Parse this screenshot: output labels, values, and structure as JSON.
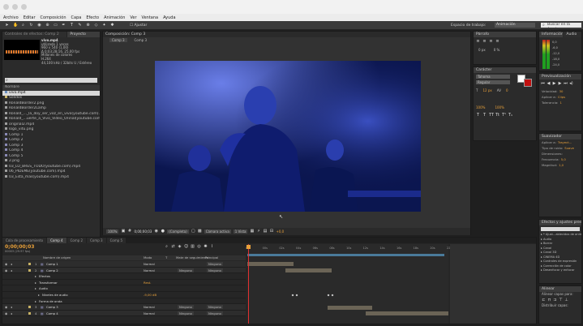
{
  "menu": {
    "items": [
      "Archivo",
      "Editar",
      "Composición",
      "Capa",
      "Efecto",
      "Animación",
      "Ver",
      "Ventana",
      "Ayuda"
    ]
  },
  "toolbar": {
    "snap_label": "Ajustar",
    "workspace_label": "Espacio de trabajo:",
    "workspace_value": "Animación",
    "help_placeholder": "Buscar en la Ayuda"
  },
  "project": {
    "tab_effects": "Controles de efectos: Comp 2",
    "tab_project": "Proyecto",
    "item_name": "vivo.mp4",
    "item_info": [
      "utilizado 1 veces",
      "960 x 540 (1,00)",
      "Δ 0;03;28;16, 25,00 fps",
      "Millones de colores",
      "H.264",
      "44,100 kHz / 32bits U / Estéreo"
    ],
    "search_placeholder": "",
    "col_name": "Nombre",
    "files": [
      {
        "name": "vivo.mp4",
        "color": "#6a8fbf",
        "selected": true
      },
      {
        "name": "Sólidos",
        "color": "#c8b264"
      },
      {
        "name": "RonaldBorder2.png",
        "color": "#9f9f9f"
      },
      {
        "name": "RonaldBorder2Lamp",
        "color": "#9f9f9f"
      },
      {
        "name": "Ronald_..._la_doy_ser_voz_en_vivo(youtube.com).mp4",
        "color": "#9f9f9f"
      },
      {
        "name": "Ronald_...uerte_a_Vivo_Video_OFinal(youtube.com).mp4",
        "color": "#9f9f9f"
      },
      {
        "name": "original2.mp4",
        "color": "#9f9f9f"
      },
      {
        "name": "logo_vitu.png",
        "color": "#9f9f9f"
      },
      {
        "name": "Comp 1",
        "color": "#8a8ab5"
      },
      {
        "name": "Comp 2",
        "color": "#8a8ab5"
      },
      {
        "name": "Comp 3",
        "color": "#8a8ab5"
      },
      {
        "name": "Comp 4",
        "color": "#8a8ab5"
      },
      {
        "name": "Comp 5",
        "color": "#8a8ab5"
      },
      {
        "name": "2.png",
        "color": "#9f9f9f"
      },
      {
        "name": "03_LO_BRES_TODO(youtube.com).mp4",
        "color": "#9f9f9f"
      },
      {
        "name": "06_PIDEME(youtube.com).mp4",
        "color": "#9f9f9f"
      },
      {
        "name": "03_Esta_mas(youtube.com).mp4",
        "color": "#9f9f9f"
      }
    ]
  },
  "composition": {
    "tab": "Composición: Comp 3",
    "subtabs": [
      "Comp 3",
      "Comp 3"
    ],
    "zoom": "100%",
    "timecode": "0;00;00;03",
    "resolution": "(Completa)",
    "camera": "Cámara activa",
    "views": "1 Vista",
    "offset": "+0,0"
  },
  "right_panels": {
    "info_tab": "Información",
    "audio_tab": "Audio",
    "audio_levels": [
      "0,0",
      "-6,0",
      "-12,0",
      "-18,0",
      "-24,0"
    ],
    "preview_tab": "Previsualización",
    "preview_fields": [
      {
        "label": "Velocidad:",
        "value": "30"
      },
      {
        "label": "Aplicar a:",
        "value": "Clips"
      },
      {
        "label": "Tolerancia:",
        "value": "1"
      }
    ],
    "smoother_tab": "Suavizador",
    "smoother_fields": [
      {
        "label": "Aplicar a:",
        "value": "Trayect..."
      },
      {
        "label": "Tipo de ruido:",
        "value": "Suave"
      },
      {
        "label": "Dimensiones:",
        "value": ""
      },
      {
        "label": "Frecuencia:",
        "value": "5,0"
      },
      {
        "label": "Magnitud:",
        "value": "1,0"
      }
    ],
    "effects_tab": "Efectos y ajustes preestablecidos",
    "effects_list": [
      "* Ajust...ablecidos de animación",
      "Audio",
      "Borrar",
      "Canal",
      "Canal 3D",
      "CINEMA 4D",
      "Controles de expresión",
      "Corrección de color",
      "Desenfocar y enfocar"
    ],
    "align_tab": "Alinear",
    "align_label": "Alinear capas para:",
    "distribute_label": "Distribuir capas:"
  },
  "paragraph": {
    "tab": "Carácter",
    "tab2": "Párrafo",
    "font": "Tahoma",
    "style": "Regular",
    "size": "12 px",
    "tracking": "0",
    "percents": [
      "100%",
      "100%"
    ],
    "px_values": [
      "0 px",
      "0 %"
    ]
  },
  "timeline": {
    "tabs": [
      "Cola de procesamiento",
      "Comp 4",
      "Comp 2",
      "Comp 3",
      "Comp 5"
    ],
    "timecode": "0;00;00;03",
    "fps_note": "00003 (29.97 fps)",
    "cols": [
      "Nombre de origen",
      "Modo",
      "T",
      "Mate de seguimiento",
      "Principal"
    ],
    "ruler": [
      "0s",
      "00s",
      "02s",
      "04s",
      "06s",
      "08s",
      "10s",
      "12s",
      "14s",
      "16s",
      "18s",
      "20s",
      "22s"
    ],
    "layers": [
      {
        "num": "1",
        "name": "Comp 1",
        "mode": "Normal",
        "track": "",
        "parent": "Ninguno",
        "indent": 0,
        "bar_start": 0.0,
        "bar_end": 0.23,
        "bar_color": "#6b6456",
        "kind": "layer"
      },
      {
        "num": "2",
        "name": "Comp 2",
        "mode": "Normal",
        "track": "Ninguno",
        "parent": "Ninguno",
        "indent": 0,
        "bar_start": 0.19,
        "bar_end": 0.42,
        "bar_color": "#6b6456",
        "kind": "layer"
      },
      {
        "num": "",
        "name": "Efectos",
        "mode": "",
        "track": "",
        "parent": "",
        "indent": 1,
        "kind": "prop"
      },
      {
        "num": "",
        "name": "Transformar",
        "mode": "Rest.",
        "track": "",
        "parent": "",
        "indent": 1,
        "kind": "prop"
      },
      {
        "num": "",
        "name": "Audio",
        "mode": "",
        "track": "",
        "parent": "",
        "indent": 1,
        "kind": "prop"
      },
      {
        "num": "",
        "name": "Niveles de audio",
        "mode": "-9,00 dB",
        "track": "",
        "parent": "",
        "indent": 2,
        "kind": "prop"
      },
      {
        "num": "",
        "name": "Forma de onda",
        "mode": "",
        "track": "",
        "parent": "",
        "indent": 1,
        "kind": "prop"
      },
      {
        "num": "3",
        "name": "Comp 3",
        "mode": "Normal",
        "track": "Ninguno",
        "parent": "Ninguno",
        "indent": 0,
        "bar_start": 0.4,
        "bar_end": 0.62,
        "bar_color": "#6b6456",
        "kind": "layer"
      },
      {
        "num": "4",
        "name": "Comp 4",
        "mode": "Normal",
        "track": "Ninguno",
        "parent": "Ninguno",
        "indent": 0,
        "bar_start": 0.59,
        "bar_end": 1.0,
        "bar_color": "#6b6456",
        "kind": "layer"
      }
    ],
    "playhead": 0.0,
    "work_area_end": 0.98
  }
}
